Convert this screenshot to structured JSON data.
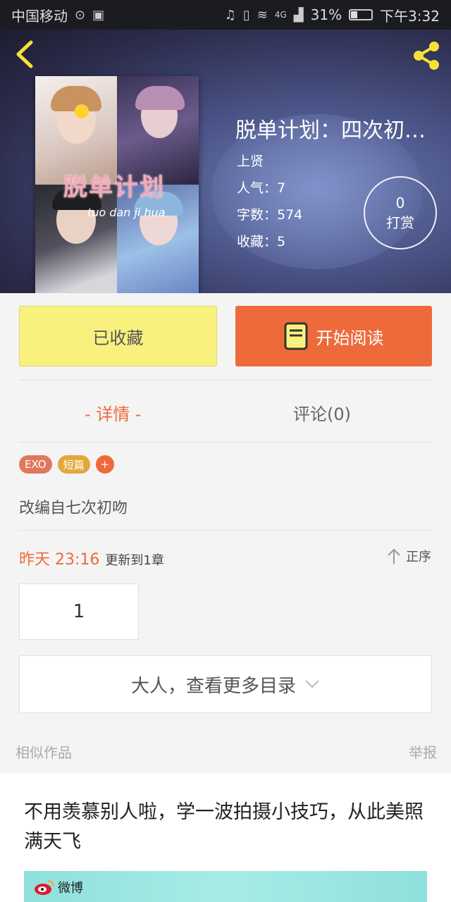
{
  "status_bar": {
    "carrier": "中国移动",
    "signal": "4G",
    "battery": "31%",
    "battery_level": 0.31,
    "time": "下午3:32"
  },
  "book": {
    "title": "脱单计划：四次初…",
    "author": "上贤",
    "popularity": "人气：7",
    "word_count": "字数：574",
    "favorites": "收藏：5",
    "reward_count": "0",
    "reward_label": "打赏",
    "cover_title": "脱单计划",
    "cover_subtitle": "tuo dan ji hua"
  },
  "actions": {
    "favorited_label": "已收藏",
    "start_read_label": "开始阅读"
  },
  "tabs": {
    "detail": "- 详情 -",
    "comments": "评论(0)"
  },
  "tags": [
    "EXO",
    "短篇",
    "+"
  ],
  "description": "改编自七次初吻",
  "update": {
    "time": "昨天 23:16",
    "text": "更新到1章"
  },
  "sort_label": "正序",
  "chapter": "1",
  "more_catalog": "大人，查看更多目录",
  "similar_label": "相似作品",
  "report_label": "举报",
  "ad": {
    "title": "不用羡慕别人啦，学一波拍摄小技巧，从此美照满天飞",
    "source": "微博"
  },
  "colors": {
    "accent": "#ee6a3b",
    "fav_button": "#f9f17e",
    "tag_exo": "#e0785d",
    "tag_short": "#e2a83c"
  }
}
